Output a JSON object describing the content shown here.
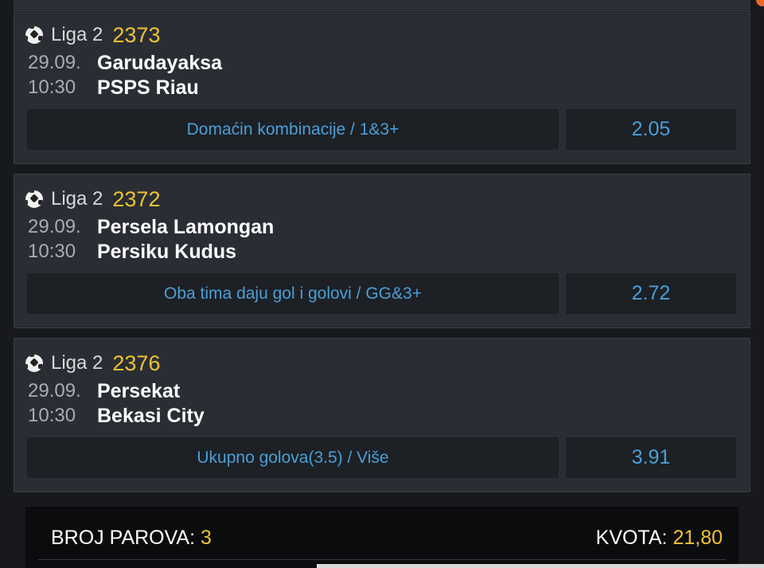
{
  "matches": [
    {
      "league": "Liga 2",
      "id": "2373",
      "date": "29.09.",
      "time": "10:30",
      "home": "Garudayaksa",
      "away": "PSPS Riau",
      "bet": "Domaćin kombinacije / 1&3+",
      "odd": "2.05"
    },
    {
      "league": "Liga 2",
      "id": "2372",
      "date": "29.09.",
      "time": "10:30",
      "home": "Persela Lamongan",
      "away": "Persiku Kudus",
      "bet": "Oba tima daju gol i golovi / GG&3+",
      "odd": "2.72"
    },
    {
      "league": "Liga 2",
      "id": "2376",
      "date": "29.09.",
      "time": "10:30",
      "home": "Persekat",
      "away": "Bekasi City",
      "bet": "Ukupno golova(3.5) / Više",
      "odd": "3.91"
    }
  ],
  "summary": {
    "pairs_label": "BROJ PAROVA:",
    "pairs_value": "3",
    "odds_label": "KVOTA:",
    "odds_value": "21,80"
  },
  "icons": {
    "sport": "soccer-ball-icon"
  },
  "colors": {
    "accent_yellow": "#f1c232",
    "accent_blue": "#4a9fd8",
    "background": "#17191c"
  }
}
